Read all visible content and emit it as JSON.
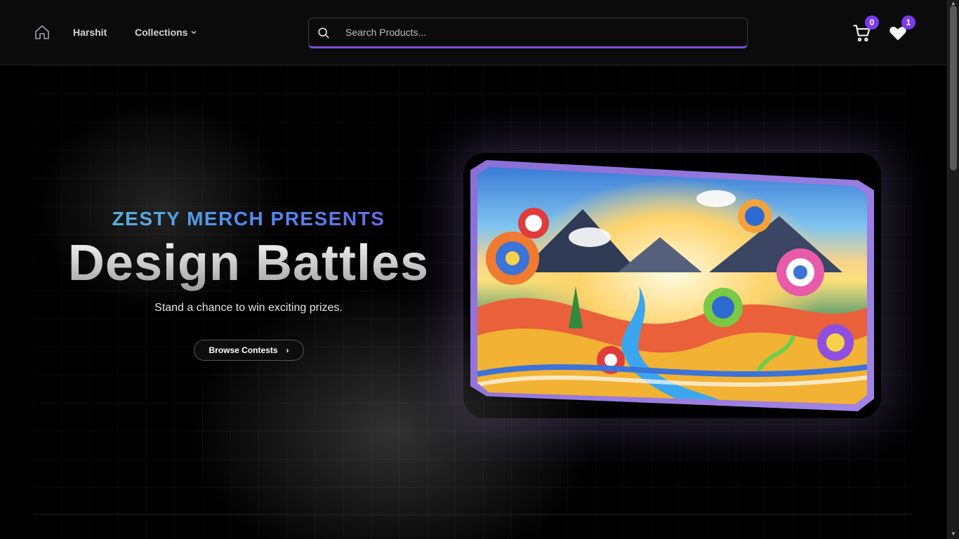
{
  "header": {
    "home_icon": "home-icon",
    "user_link": "Harshit",
    "collections_link": "Collections",
    "search_placeholder": "Search Products...",
    "cart_count": "0",
    "wishlist_count": "1",
    "accent_color": "#7c3aed"
  },
  "hero": {
    "eyebrow": "ZESTY MERCH PRESENTS",
    "headline": "Design Battles",
    "subtitle": "Stand a chance to win exciting prizes.",
    "cta_label": "Browse Contests",
    "banner_image": "colorful-abstract-landscape-artwork"
  }
}
